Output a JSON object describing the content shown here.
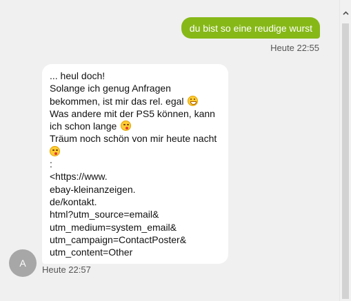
{
  "messages": {
    "outgoing": {
      "text": "du bist so eine reudige wurst",
      "time": "Heute 22:55"
    },
    "incoming": {
      "lines": {
        "l1": "... heul doch!",
        "l2": "Solange ich genug Anfragen",
        "l3": "bekommen, ist mir das rel. egal",
        "l4": "Was andere mit der PS5 können, kann",
        "l5": "ich schon lange",
        "l6": "Träum noch schön von mir heute nacht",
        "l7": ":",
        "l8": "<https://www.",
        "l9": "ebay-kleinanzeigen.",
        "l10": "de/kontakt.",
        "l11": "html?utm_source=email&",
        "l12": "utm_medium=system_email&",
        "l13": "utm_campaign=ContactPoster&",
        "l14": "utm_content=Other"
      },
      "emojis": [
        "grinning-face-icon",
        "winking-kiss-face-icon",
        "winking-kiss-face-icon"
      ],
      "time": "Heute 22:57",
      "avatar_initial": "A"
    }
  },
  "colors": {
    "outgoing_bubble": "#86b817",
    "background": "#f0f0f0",
    "avatar": "#a7a7a7"
  }
}
